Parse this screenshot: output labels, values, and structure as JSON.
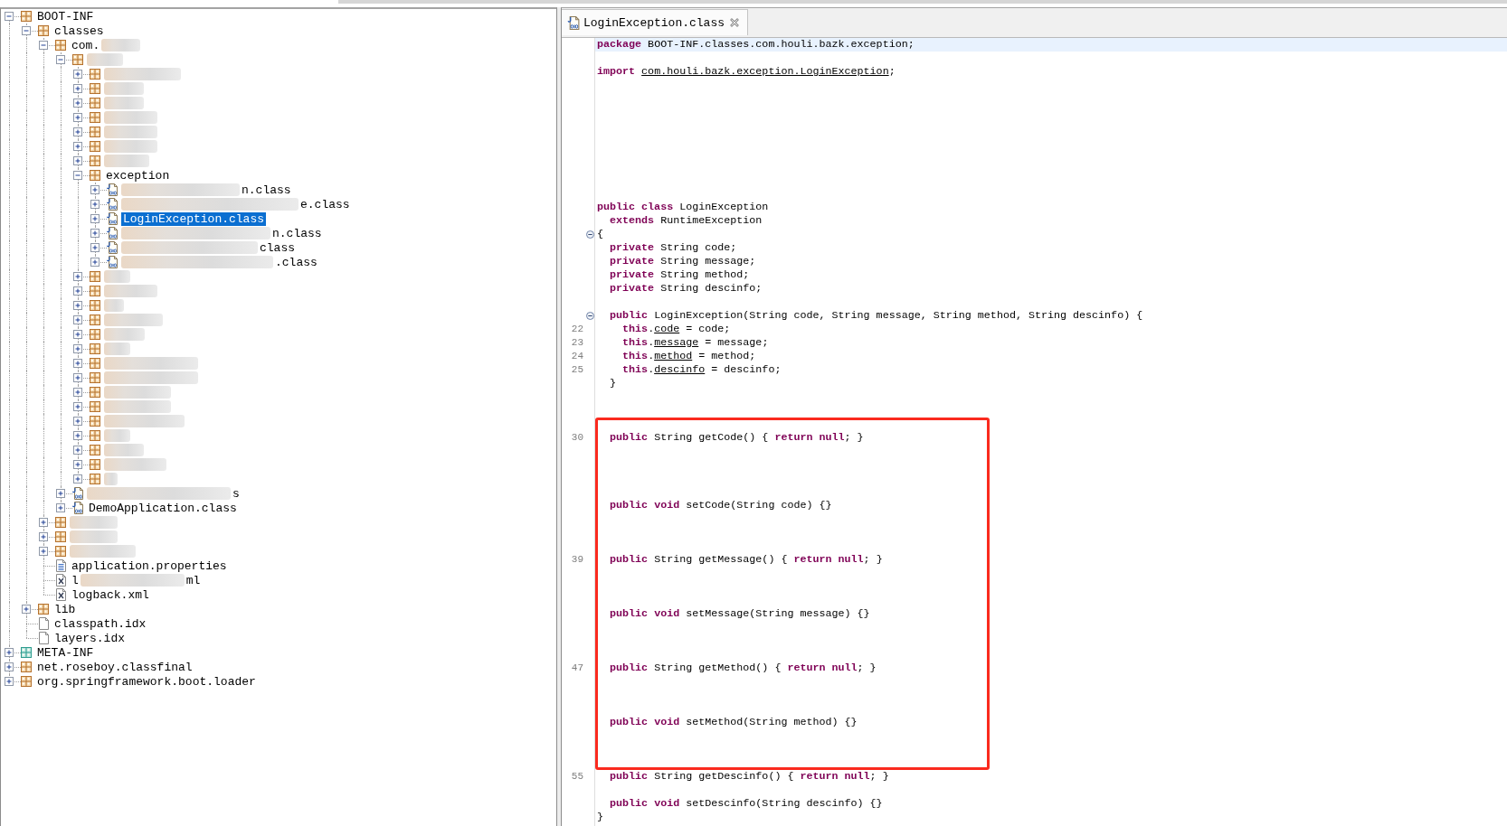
{
  "tree": [
    {
      "label": "BOOT-INF",
      "kind": "package",
      "blurred": false,
      "expanded": true,
      "selected": false,
      "children": [
        {
          "label": "classes",
          "kind": "package",
          "blurred": false,
          "expanded": true,
          "selected": false,
          "children": [
            {
              "visible_start": "com.",
              "kind": "package",
              "blurred": true,
              "expanded": true,
              "selected": false,
              "children": [
                {
                  "kind": "package",
                  "blurred": true,
                  "expanded": true,
                  "selected": false,
                  "children": [
                    {
                      "kind": "package",
                      "blurred": true,
                      "expanded": false,
                      "selected": false
                    },
                    {
                      "kind": "package",
                      "blurred": true,
                      "expanded": false,
                      "selected": false
                    },
                    {
                      "kind": "package",
                      "blurred": true,
                      "expanded": false,
                      "selected": false
                    },
                    {
                      "kind": "package",
                      "blurred": true,
                      "expanded": false,
                      "selected": false
                    },
                    {
                      "kind": "package",
                      "blurred": true,
                      "expanded": false,
                      "selected": false
                    },
                    {
                      "kind": "package",
                      "blurred": true,
                      "expanded": false,
                      "selected": false
                    },
                    {
                      "kind": "package",
                      "blurred": true,
                      "expanded": false,
                      "selected": false
                    },
                    {
                      "label": "exception",
                      "kind": "package",
                      "blurred": false,
                      "expanded": true,
                      "selected": false,
                      "children": [
                        {
                          "visible_end": "n.class",
                          "kind": "class",
                          "blurred": true,
                          "expanded": false,
                          "selected": false
                        },
                        {
                          "visible_end": "e.class",
                          "kind": "class",
                          "blurred": true,
                          "expanded": false,
                          "selected": false
                        },
                        {
                          "label": "LoginException.class",
                          "kind": "class",
                          "blurred": false,
                          "expanded": false,
                          "selected": true
                        },
                        {
                          "visible_end": "n.class",
                          "kind": "class",
                          "blurred": true,
                          "expanded": false,
                          "selected": false
                        },
                        {
                          "visible_end": "class",
                          "kind": "class",
                          "blurred": true,
                          "expanded": false,
                          "selected": false
                        },
                        {
                          "visible_end": ".class",
                          "kind": "class",
                          "blurred": true,
                          "expanded": false,
                          "selected": false
                        }
                      ]
                    },
                    {
                      "kind": "package",
                      "blurred": true,
                      "expanded": false,
                      "selected": false
                    },
                    {
                      "kind": "package",
                      "blurred": true,
                      "expanded": false,
                      "selected": false
                    },
                    {
                      "kind": "package",
                      "blurred": true,
                      "expanded": false,
                      "selected": false
                    },
                    {
                      "kind": "package",
                      "blurred": true,
                      "expanded": false,
                      "selected": false
                    },
                    {
                      "kind": "package",
                      "blurred": true,
                      "expanded": false,
                      "selected": false
                    },
                    {
                      "kind": "package",
                      "blurred": true,
                      "expanded": false,
                      "selected": false
                    },
                    {
                      "kind": "package",
                      "blurred": true,
                      "expanded": false,
                      "selected": false
                    },
                    {
                      "kind": "package",
                      "blurred": true,
                      "expanded": false,
                      "selected": false
                    },
                    {
                      "kind": "package",
                      "blurred": true,
                      "expanded": false,
                      "selected": false
                    },
                    {
                      "kind": "package",
                      "blurred": true,
                      "expanded": false,
                      "selected": false
                    },
                    {
                      "kind": "package",
                      "blurred": true,
                      "expanded": false,
                      "selected": false
                    },
                    {
                      "kind": "package",
                      "blurred": true,
                      "expanded": false,
                      "selected": false
                    },
                    {
                      "kind": "package",
                      "blurred": true,
                      "expanded": false,
                      "selected": false
                    },
                    {
                      "kind": "package",
                      "blurred": true,
                      "expanded": false,
                      "selected": false
                    },
                    {
                      "kind": "package",
                      "blurred": true,
                      "expanded": false,
                      "selected": false
                    }
                  ]
                },
                {
                  "visible_end": "s",
                  "kind": "class",
                  "blurred": true,
                  "expanded": false,
                  "selected": false
                },
                {
                  "label": "DemoApplication.class",
                  "kind": "class",
                  "blurred": false,
                  "expanded": false,
                  "selected": false
                }
              ]
            },
            {
              "kind": "package",
              "blurred": true,
              "expanded": false,
              "selected": false
            },
            {
              "kind": "package",
              "blurred": true,
              "expanded": false,
              "selected": false
            },
            {
              "kind": "package",
              "blurred": true,
              "expanded": false,
              "selected": false
            },
            {
              "label": "application.properties",
              "kind": "properties",
              "blurred": false,
              "selected": false
            },
            {
              "visible_start": "l",
              "visible_end": "ml",
              "kind": "xml",
              "blurred": true,
              "selected": false
            },
            {
              "label": "logback.xml",
              "kind": "xml",
              "blurred": false,
              "selected": false
            }
          ]
        },
        {
          "label": "lib",
          "kind": "package",
          "blurred": false,
          "expanded": false,
          "selected": false
        },
        {
          "label": "classpath.idx",
          "kind": "file",
          "blurred": false,
          "selected": false
        },
        {
          "label": "layers.idx",
          "kind": "file",
          "blurred": false,
          "selected": false
        }
      ]
    },
    {
      "label": "META-INF",
      "kind": "folder",
      "blurred": false,
      "expanded": false,
      "selected": false
    },
    {
      "label": "net.roseboy.classfinal",
      "kind": "package",
      "blurred": false,
      "expanded": false,
      "selected": false
    },
    {
      "label": "org.springframework.boot.loader",
      "kind": "package",
      "blurred": false,
      "expanded": false,
      "selected": false
    }
  ],
  "editor": {
    "tabs": [
      {
        "label": "LoginException.class",
        "selected": true
      }
    ],
    "sections": [
      {
        "framed": false,
        "lines": [
          {
            "current": true,
            "tokens": [
              {
                "kind": "keyword",
                "text": "package"
              },
              {
                "kind": "plain",
                "text": " BOOT-INF.classes.com.houli.bazk.exception;"
              }
            ]
          },
          {
            "current": false,
            "tokens": [
              {
                "kind": "keyword",
                "text": "import "
              },
              {
                "kind": "ref",
                "text": "com.houli.bazk.exception.LoginException"
              },
              {
                "kind": "plain",
                "text": ";"
              }
            ]
          },
          {
            "current": false,
            "tokens": [
              {
                "kind": "keyword",
                "text": "public class"
              },
              {
                "kind": "plain",
                "text": " LoginException"
              }
            ]
          },
          {
            "current": false,
            "tokens": [
              {
                "kind": "keyword",
                "text": "  extends"
              },
              {
                "kind": "plain",
                "text": " RuntimeException"
              }
            ]
          },
          {
            "current": false,
            "fold": {
              "expanded": true
            },
            "tokens": [
              {
                "kind": "plain",
                "text": "{"
              }
            ]
          },
          {
            "current": false,
            "tokens": [
              {
                "kind": "keyword",
                "text": "  private"
              },
              {
                "kind": "plain",
                "text": " String code;"
              }
            ]
          },
          {
            "current": false,
            "tokens": [
              {
                "kind": "keyword",
                "text": "  private"
              },
              {
                "kind": "plain",
                "text": " String message;"
              }
            ]
          },
          {
            "current": false,
            "tokens": [
              {
                "kind": "keyword",
                "text": "  private"
              },
              {
                "kind": "plain",
                "text": " String method;"
              }
            ]
          },
          {
            "current": false,
            "tokens": [
              {
                "kind": "keyword",
                "text": "  private"
              },
              {
                "kind": "plain",
                "text": " String descinfo;"
              }
            ]
          },
          {
            "current": false,
            "fold": {
              "expanded": true
            },
            "tokens": [
              {
                "kind": "keyword",
                "text": "  public"
              },
              {
                "kind": "plain",
                "text": " LoginException(String code, String message, String method, String descinfo) {"
              }
            ]
          },
          {
            "current": false,
            "line_number": "22",
            "tokens": [
              {
                "kind": "keyword",
                "text": "    this"
              },
              {
                "kind": "plain",
                "text": "."
              },
              {
                "kind": "ref",
                "text": "code"
              },
              {
                "kind": "plain",
                "text": " = code;"
              }
            ]
          },
          {
            "current": false,
            "line_number": "23",
            "tokens": [
              {
                "kind": "keyword",
                "text": "    this"
              },
              {
                "kind": "plain",
                "text": "."
              },
              {
                "kind": "ref",
                "text": "message"
              },
              {
                "kind": "plain",
                "text": " = message;"
              }
            ]
          },
          {
            "current": false,
            "line_number": "24",
            "tokens": [
              {
                "kind": "keyword",
                "text": "    this"
              },
              {
                "kind": "plain",
                "text": "."
              },
              {
                "kind": "ref",
                "text": "method"
              },
              {
                "kind": "plain",
                "text": " = method;"
              }
            ]
          },
          {
            "current": false,
            "line_number": "25",
            "tokens": [
              {
                "kind": "keyword",
                "text": "    this"
              },
              {
                "kind": "plain",
                "text": "."
              },
              {
                "kind": "ref",
                "text": "descinfo"
              },
              {
                "kind": "plain",
                "text": " = descinfo;"
              }
            ]
          },
          {
            "current": false,
            "tokens": [
              {
                "kind": "plain",
                "text": "  }"
              }
            ]
          }
        ]
      },
      {
        "framed": true,
        "lines": [
          {
            "current": false,
            "line_number": "30",
            "tokens": [
              {
                "kind": "keyword",
                "text": "  public"
              },
              {
                "kind": "plain",
                "text": " String getCode() { "
              },
              {
                "kind": "keyword",
                "text": "return null"
              },
              {
                "kind": "plain",
                "text": "; }"
              }
            ]
          },
          {
            "current": false,
            "tokens": [
              {
                "kind": "keyword",
                "text": "  public void"
              },
              {
                "kind": "plain",
                "text": " setCode(String code) {}"
              }
            ]
          },
          {
            "current": false,
            "line_number": "39",
            "tokens": [
              {
                "kind": "keyword",
                "text": "  public"
              },
              {
                "kind": "plain",
                "text": " String getMessage() { "
              },
              {
                "kind": "keyword",
                "text": "return null"
              },
              {
                "kind": "plain",
                "text": "; }"
              }
            ]
          },
          {
            "current": false,
            "tokens": [
              {
                "kind": "keyword",
                "text": "  public void"
              },
              {
                "kind": "plain",
                "text": " setMessage(String message) {}"
              }
            ]
          },
          {
            "current": false,
            "line_number": "47",
            "tokens": [
              {
                "kind": "keyword",
                "text": "  public"
              },
              {
                "kind": "plain",
                "text": " String getMethod() { "
              },
              {
                "kind": "keyword",
                "text": "return null"
              },
              {
                "kind": "plain",
                "text": "; }"
              }
            ]
          },
          {
            "current": false,
            "tokens": [
              {
                "kind": "keyword",
                "text": "  public void"
              },
              {
                "kind": "plain",
                "text": " setMethod(String method) {}"
              }
            ]
          }
        ]
      },
      {
        "framed": false,
        "lines": [
          {
            "current": false,
            "line_number": "55",
            "tokens": [
              {
                "kind": "keyword",
                "text": "  public"
              },
              {
                "kind": "plain",
                "text": " String getDescinfo() { "
              },
              {
                "kind": "keyword",
                "text": "return null"
              },
              {
                "kind": "plain",
                "text": "; }"
              }
            ]
          },
          {
            "current": false,
            "tokens": [
              {
                "kind": "keyword",
                "text": "  public void"
              },
              {
                "kind": "plain",
                "text": " setDescinfo(String descinfo) {}"
              }
            ]
          },
          {
            "current": false,
            "tokens": [
              {
                "kind": "plain",
                "text": "}"
              }
            ]
          }
        ]
      }
    ]
  }
}
